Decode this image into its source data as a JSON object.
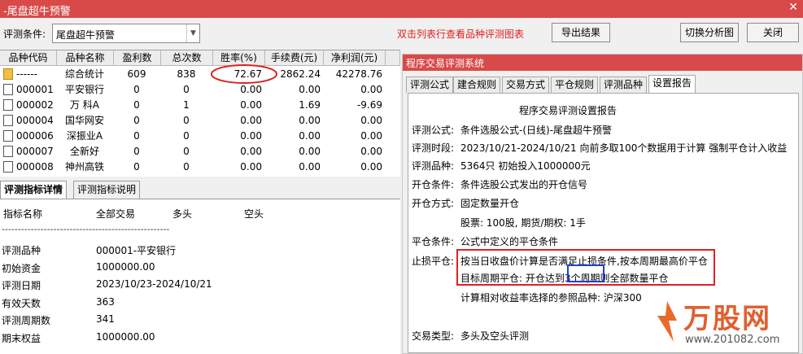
{
  "window": {
    "title": "-尾盘超牛预警",
    "close_glyph": "✕"
  },
  "toolbar": {
    "condition_label": "评测条件:",
    "condition_value": "尾盘超牛预警",
    "hint": "双击列表行查看品种评测图表",
    "export": "导出结果",
    "switch": "切换分析图",
    "close": "关闭"
  },
  "grid": {
    "headers": [
      "品种代码",
      "品种名称",
      "盈利数",
      "总次数",
      "胜率(%)",
      "手续费(元)",
      "净利润(元)"
    ],
    "rows": [
      [
        "------",
        "综合统计",
        "609",
        "838",
        "72.67",
        "2862.24",
        "42278.76"
      ],
      [
        "000001",
        "平安银行",
        "0",
        "0",
        "0.00",
        "0.00",
        "0.00"
      ],
      [
        "000002",
        "万 科A",
        "0",
        "1",
        "0.00",
        "1.69",
        "-9.69"
      ],
      [
        "000004",
        "国华网安",
        "0",
        "0",
        "0.00",
        "0.00",
        "0.00"
      ],
      [
        "000006",
        "深振业A",
        "0",
        "0",
        "0.00",
        "0.00",
        "0.00"
      ],
      [
        "000007",
        "全新好",
        "0",
        "0",
        "0.00",
        "0.00",
        "0.00"
      ],
      [
        "000008",
        "神州高铁",
        "0",
        "0",
        "0.00",
        "0.00",
        "0.00"
      ]
    ]
  },
  "left_tabs": [
    "评测指标详情",
    "评测指标说明"
  ],
  "left_panel": {
    "columns": [
      "指标名称",
      "全部交易",
      "多头",
      "空头"
    ],
    "divider": "----------------------------------------------------",
    "metrics": [
      {
        "name": "评测品种",
        "value": "000001-平安银行"
      },
      {
        "name": "初始资金",
        "value": "1000000.00"
      },
      {
        "name": "评测日期",
        "value": "2023/10/23-2024/10/21"
      },
      {
        "name": "有效天数",
        "value": "363"
      },
      {
        "name": "评测周期数",
        "value": "341"
      },
      {
        "name": "期末权益",
        "value": "1000000.00"
      }
    ]
  },
  "dialog": {
    "title": "程序交易评测系统",
    "tabs": [
      "评测公式",
      "建合规则",
      "交易方式",
      "平仓规则",
      "评测品种",
      "设置报告"
    ],
    "report_title": "程序交易评测设置报告",
    "lines": [
      {
        "label": "评测公式:",
        "text": "条件选股公式-(日线)-尾盘超牛预警"
      },
      {
        "label": "评测时段:",
        "text": "2023/10/21-2024/10/21 向前多取100个数据用于计算 强制平仓计入收益"
      },
      {
        "label": "评测品种:",
        "text": "5364只 初始投入1000000元"
      },
      {
        "label": "开仓条件:",
        "text": "条件选股公式发出的开仓信号"
      },
      {
        "label": "开仓方式:",
        "text": "固定数量开仓"
      },
      {
        "label": "",
        "text": "股票: 100股, 期货/期权: 1手"
      },
      {
        "label": "平仓条件:",
        "text": "公式中定义的平仓条件"
      },
      {
        "label": "止损平仓:",
        "text": "按当日收盘价计算是否满足止损条件,按本周期最高价平仓"
      },
      {
        "label": "",
        "text_a": "目标周期平仓: 开仓达到",
        "text_b": "3个周期",
        "text_c": "则全部数量平仓"
      },
      {
        "label": "",
        "text": "计算相对收益率选择的参照品种: 沪深300"
      },
      {
        "label": "交易类型:",
        "text": "多头及空头评测"
      }
    ]
  },
  "watermark": {
    "logo": "万股网",
    "site": "www.201082.com",
    "mark": "万股网"
  },
  "colors": {
    "title_bg": "#d84a4a",
    "hint_red": "#e02020",
    "highlight_blue": "#2040d0"
  }
}
